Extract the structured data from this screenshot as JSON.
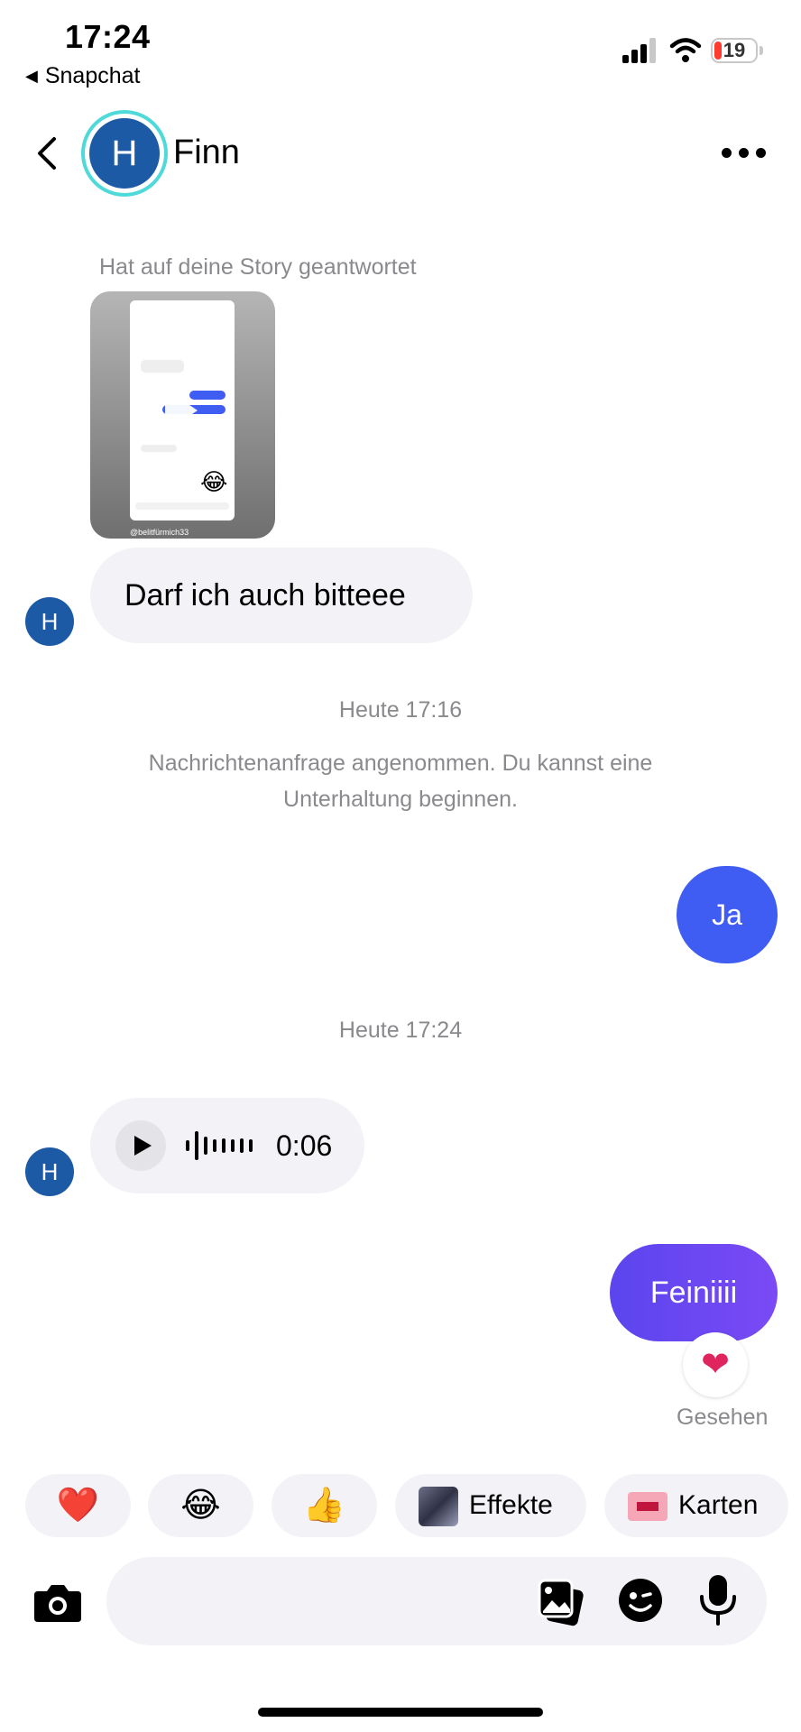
{
  "status_bar": {
    "time": "17:24",
    "back_app": "Snapchat",
    "battery": "19",
    "battery_level": 0.19,
    "signal_bars": 3,
    "icons": [
      "cellular-signal-icon",
      "wifi-icon",
      "battery-icon"
    ]
  },
  "header": {
    "avatar_initial": "H",
    "contact_name": "Finn",
    "icons": [
      "back-arrow-icon",
      "more-dots-icon"
    ]
  },
  "conversation": {
    "story_reply_caption": "Hat auf deine Story geantwortet",
    "story_credit": "@belitfürmich33",
    "incoming_avatar_initial": "H",
    "msg1": "Darf ich auch bitteee",
    "timestamp1": "Heute 17:16",
    "system_message": "Nachrichtenanfrage angenommen. Du kannst eine Unterhaltung beginnen.",
    "msg2": "Ja",
    "timestamp2": "Heute 17:24",
    "voice_duration": "0:06",
    "msg4": "Feiniiii",
    "msg4_reaction": "❤",
    "seen": "Gesehen"
  },
  "quick_reactions": {
    "heart": "❤️",
    "laugh": "😂",
    "thumbs_up": "👍",
    "effects_label": "Effekte",
    "cards_label": "Karten"
  },
  "input_bar": {
    "placeholder": "",
    "icons": [
      "camera-icon",
      "gallery-icon",
      "sticker-icon",
      "microphone-icon"
    ]
  },
  "colors": {
    "outgoing_blue": "#3f5cf3",
    "outgoing_purple": "#6a48f2",
    "avatar_blue": "#1d5aa6",
    "story_ring": "#4fd9d9",
    "incoming_bubble": "#f3f2f7"
  }
}
